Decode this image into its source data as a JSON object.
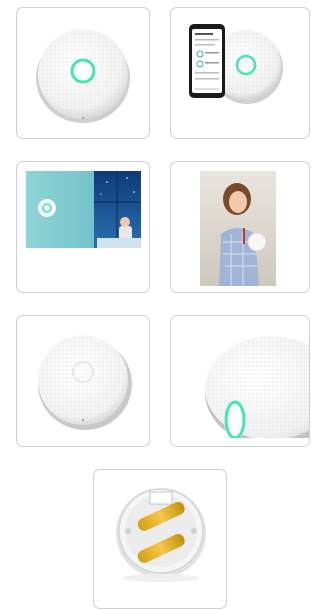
{
  "gallery": {
    "thumbnails": [
      {
        "icon": "air-sensor-front-image"
      },
      {
        "icon": "air-sensor-with-phone-app-image"
      },
      {
        "icon": "air-sensor-bedroom-scene-image"
      },
      {
        "icon": "woman-holding-sensor-image"
      },
      {
        "icon": "air-sensor-angle-image"
      },
      {
        "icon": "air-sensor-side-closeup-image"
      },
      {
        "icon": "battery-compartment-image"
      }
    ]
  }
}
